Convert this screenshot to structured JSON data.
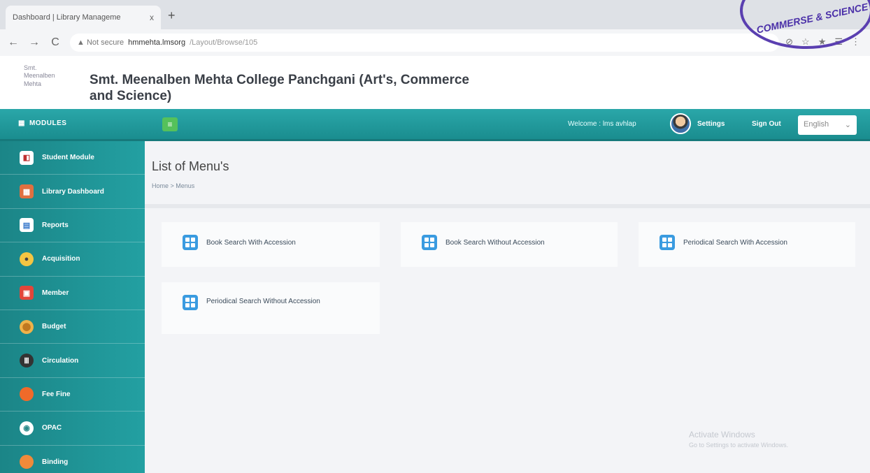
{
  "browser": {
    "tab_title": "Dashboard | Library Manageme",
    "tab_close": "x",
    "new_tab": "+",
    "back": "←",
    "forward": "→",
    "reload": "C",
    "security_label": "▲ Not secure",
    "url_host": "hmmehta.lmsorg",
    "url_path": "/Layout/Browse/105",
    "icons": [
      "⊘",
      "☆",
      "★",
      "☰",
      "⋮"
    ]
  },
  "header": {
    "logo_alt": "Smt. Meenalben Mehta",
    "college_name": "Smt. Meenalben Mehta College Panchgani (Art's, Commerce and Science)"
  },
  "topnav": {
    "modules_label": "MODULES",
    "toggle": "≡",
    "welcome_text": "Welcome : lms avhlap",
    "settings_label": "Settings",
    "signout_label": "Sign Out",
    "language": "English",
    "language_arrow": "⌄"
  },
  "sidebar": {
    "items": [
      {
        "label": "Student Module",
        "icon": "student-icon",
        "glyph": "◧",
        "color": "#ffffff",
        "glyph_color": "#c03030"
      },
      {
        "label": "Library Dashboard",
        "icon": "dashboard-icon",
        "glyph": "▦",
        "color": "#e07040",
        "glyph_color": "#ffffff"
      },
      {
        "label": "Reports",
        "icon": "reports-icon",
        "glyph": "▤",
        "color": "#ffffff",
        "glyph_color": "#3a7acc"
      },
      {
        "label": "Acquisition",
        "icon": "acquisition-icon",
        "glyph": "●",
        "color": "#f4c542",
        "glyph_color": "#444444"
      },
      {
        "label": "Member",
        "icon": "member-icon",
        "glyph": "▣",
        "color": "#e2463a",
        "glyph_color": "#ffffff"
      },
      {
        "label": "Budget",
        "icon": "budget-icon",
        "glyph": "⬤",
        "color": "#f0b24a",
        "glyph_color": "#c07820"
      },
      {
        "label": "Circulation",
        "icon": "circulation-icon",
        "glyph": "Ⅲ",
        "color": "#333333",
        "glyph_color": "#ffffff"
      },
      {
        "label": "Fee Fine",
        "icon": "fee-fine-icon",
        "glyph": "●",
        "color": "#f06a2a",
        "glyph_color": "#f06a2a"
      },
      {
        "label": "OPAC",
        "icon": "opac-icon",
        "glyph": "◉",
        "color": "#ffffff",
        "glyph_color": "#2a8a8a"
      },
      {
        "label": "Binding",
        "icon": "binding-icon",
        "glyph": "●",
        "color": "#f08a3a",
        "glyph_color": "#f08a3a"
      }
    ]
  },
  "main": {
    "title": "List of Menu's",
    "breadcrumb": "Home > Menus",
    "cards": [
      {
        "label": "Book Search With Accession"
      },
      {
        "label": "Book Search Without Accession"
      },
      {
        "label": "Periodical Search With Accession"
      },
      {
        "label": "Periodical Search Without Accession"
      }
    ]
  },
  "watermark": {
    "line1": "Activate Windows",
    "line2": "Go to Settings to activate Windows."
  },
  "stamp_text": "COMMERSE & SCIENCE"
}
